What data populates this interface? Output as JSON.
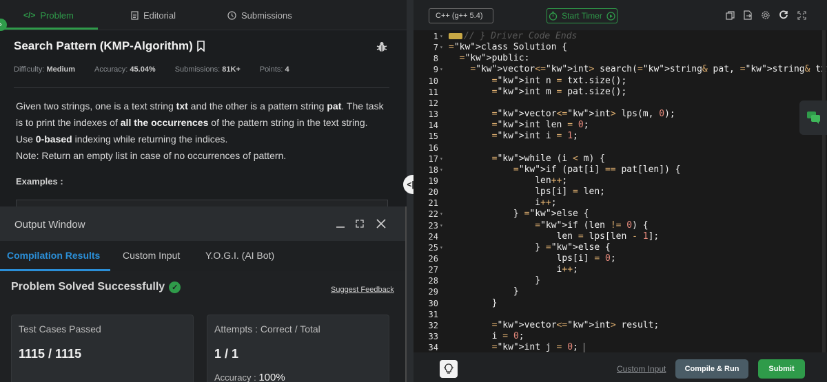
{
  "tabs": [
    {
      "icon": "code-icon",
      "label": "Problem"
    },
    {
      "icon": "document-icon",
      "label": "Editorial"
    },
    {
      "icon": "clock-icon",
      "label": "Submissions"
    }
  ],
  "problem": {
    "title": "Search Pattern (KMP-Algorithm)",
    "meta": {
      "difficulty_label": "Difficulty:",
      "difficulty": "Medium",
      "accuracy_label": "Accuracy:",
      "accuracy": "45.04%",
      "submissions_label": "Submissions:",
      "submissions": "81K+",
      "points_label": "Points:",
      "points": "4"
    },
    "desc": {
      "p1a": "Given two strings, one is a text string ",
      "p1b": "txt",
      "p1c": " and the other is a pattern string ",
      "p1d": "pat",
      "p1e": ". The task is to print the indexes of ",
      "p1f": "all the occurrences",
      "p1g": " of the pattern string in the text string. Use ",
      "p1h": "0-based",
      "p1i": " indexing while returning the indices.",
      "note": "Note: Return an empty list in case of no occurrences of pattern."
    },
    "examples_label": "Examples :"
  },
  "output": {
    "title": "Output Window",
    "tabs": [
      "Compilation Results",
      "Custom Input",
      "Y.O.G.I. (AI Bot)"
    ],
    "solved": "Problem Solved Successfully",
    "feedback": "Suggest Feedback",
    "cards": {
      "test_label": "Test Cases Passed",
      "test_value": "1115 / 1115",
      "attempts_label": "Attempts : Correct / Total",
      "attempts_value": "1 / 1",
      "accuracy_label": "Accuracy :",
      "accuracy_value": "100%"
    }
  },
  "editor": {
    "language": "C++ (g++ 5.4)",
    "timer_label": "Start Timer",
    "custom_input": "Custom Input",
    "compile_run": "Compile & Run",
    "submit": "Submit",
    "lines": [
      {
        "n": "1",
        "fold": true,
        "text": "// } Driver Code Ends"
      },
      {
        "n": "7",
        "fold": true,
        "text": "class Solution {"
      },
      {
        "n": "8",
        "fold": false,
        "text": "  public:"
      },
      {
        "n": "9",
        "fold": true,
        "text": "    vector<int> search(string& pat, string& txt) {"
      },
      {
        "n": "10",
        "fold": false,
        "text": "        int n = txt.size();"
      },
      {
        "n": "11",
        "fold": false,
        "text": "        int m = pat.size();"
      },
      {
        "n": "12",
        "fold": false,
        "text": ""
      },
      {
        "n": "13",
        "fold": false,
        "text": "        vector<int> lps(m, 0);"
      },
      {
        "n": "14",
        "fold": false,
        "text": "        int len = 0;"
      },
      {
        "n": "15",
        "fold": false,
        "text": "        int i = 1;"
      },
      {
        "n": "16",
        "fold": false,
        "text": ""
      },
      {
        "n": "17",
        "fold": true,
        "text": "        while (i < m) {"
      },
      {
        "n": "18",
        "fold": true,
        "text": "            if (pat[i] == pat[len]) {"
      },
      {
        "n": "19",
        "fold": false,
        "text": "                len++;"
      },
      {
        "n": "20",
        "fold": false,
        "text": "                lps[i] = len;"
      },
      {
        "n": "21",
        "fold": false,
        "text": "                i++;"
      },
      {
        "n": "22",
        "fold": true,
        "text": "            } else {"
      },
      {
        "n": "23",
        "fold": true,
        "text": "                if (len != 0) {"
      },
      {
        "n": "24",
        "fold": false,
        "text": "                    len = lps[len - 1];"
      },
      {
        "n": "25",
        "fold": true,
        "text": "                } else {"
      },
      {
        "n": "26",
        "fold": false,
        "text": "                    lps[i] = 0;"
      },
      {
        "n": "27",
        "fold": false,
        "text": "                    i++;"
      },
      {
        "n": "28",
        "fold": false,
        "text": "                }"
      },
      {
        "n": "29",
        "fold": false,
        "text": "            }"
      },
      {
        "n": "30",
        "fold": false,
        "text": "        }"
      },
      {
        "n": "31",
        "fold": false,
        "text": ""
      },
      {
        "n": "32",
        "fold": false,
        "text": "        vector<int> result;"
      },
      {
        "n": "33",
        "fold": false,
        "text": "        i = 0;"
      },
      {
        "n": "34",
        "fold": false,
        "text": "        int j = 0;"
      }
    ]
  }
}
